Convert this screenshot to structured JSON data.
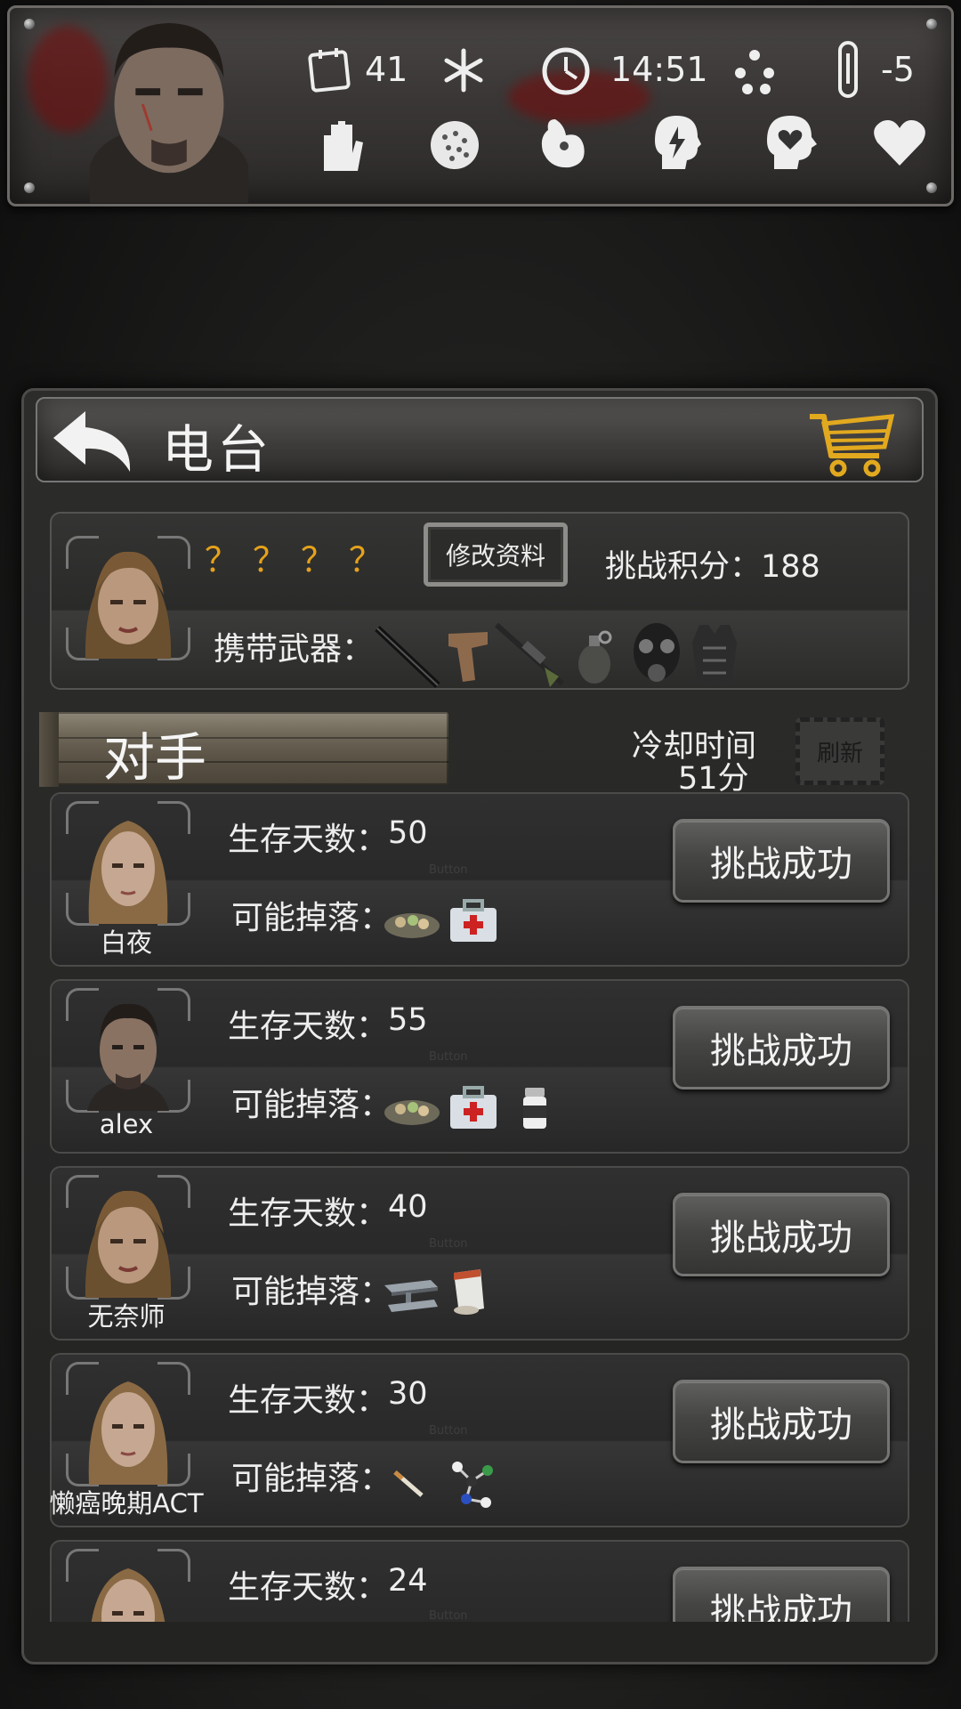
{
  "status_bar": {
    "day_count": "41",
    "time": "14:51",
    "temperature": "-5",
    "icons": [
      "calendar-icon",
      "snowflake-icon",
      "clock-icon",
      "weather-dots-icon",
      "thermometer-icon",
      "hand-icon",
      "grain-icon",
      "stomach-icon",
      "energy-head-icon",
      "mood-head-icon",
      "heart-icon"
    ]
  },
  "header": {
    "title": "电台"
  },
  "profile": {
    "name": "？？？？",
    "edit_label": "修改资料",
    "score_label": "挑战积分：",
    "score_value": "188",
    "weapons_label": "携带武器：",
    "weapons": [
      "baton",
      "pistol",
      "sniper-rifle",
      "grenade",
      "gas-mask",
      "armor-vest"
    ]
  },
  "opponents_section": {
    "title": "对手",
    "cooldown_label": "冷却时间",
    "cooldown_value": "51分",
    "refresh_label": "刷新"
  },
  "labels": {
    "days": "生存天数：",
    "drops": "可能掉落：",
    "button_ghost": "Button"
  },
  "opponents": [
    {
      "name": "白夜",
      "days": "50",
      "drops": [
        "food-tray",
        "medkit"
      ],
      "button": "挑战成功"
    },
    {
      "name": "alex",
      "days": "55",
      "drops": [
        "food-tray",
        "medkit",
        "pill-bottle"
      ],
      "button": "挑战成功"
    },
    {
      "name": "无奈师",
      "days": "40",
      "drops": [
        "steel-beam",
        "paper-cups"
      ],
      "button": "挑战成功"
    },
    {
      "name": "懒癌晚期ACT",
      "days": "30",
      "drops": [
        "cigarette",
        "molecule"
      ],
      "button": "挑战成功"
    },
    {
      "name": "",
      "days": "24",
      "drops": [],
      "button": "挑战成功"
    }
  ]
}
